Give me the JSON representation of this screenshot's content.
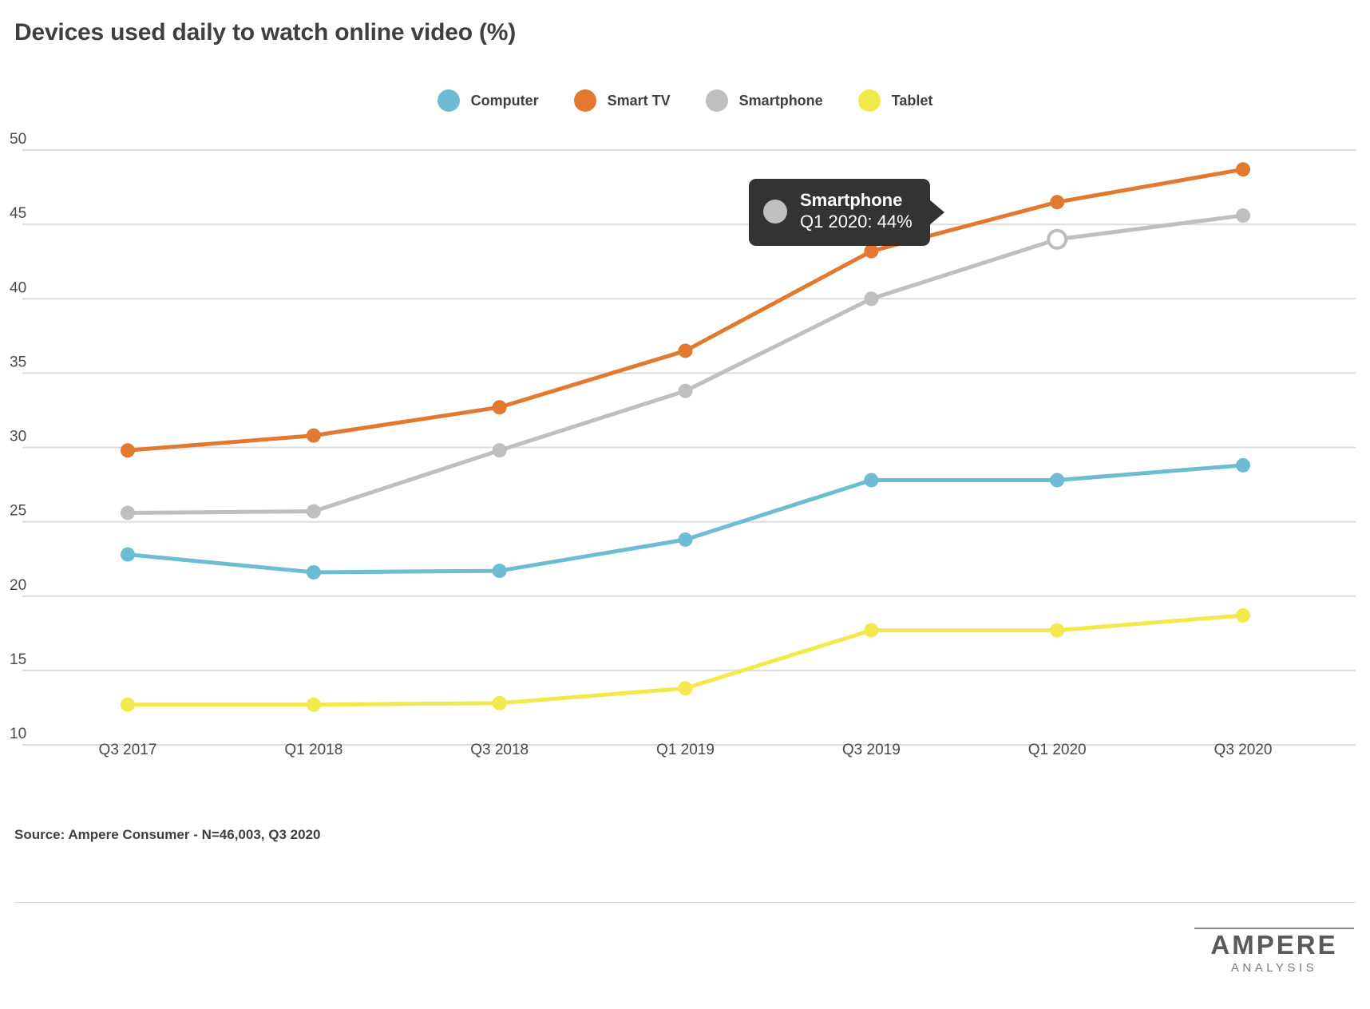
{
  "title": "Devices used daily to watch online video (%)",
  "source": "Source: Ampere Consumer - N=46,003, Q3 2020",
  "brand": {
    "name": "AMPERE",
    "sub": "ANALYSIS"
  },
  "legend": [
    {
      "label": "Computer",
      "color": "#6cbcd4"
    },
    {
      "label": "Smart TV",
      "color": "#e2792f"
    },
    {
      "label": "Smartphone",
      "color": "#bfbfbf"
    },
    {
      "label": "Tablet",
      "color": "#f2ea4c"
    }
  ],
  "tooltip": {
    "series": "Smartphone",
    "value_line": "Q1 2020: 44%",
    "color": "#bfbfbf",
    "highlight_point": {
      "x_label": "Q1 2020",
      "y": 44
    }
  },
  "chart_data": {
    "type": "line",
    "title": "Devices used daily to watch online video (%)",
    "xlabel": "",
    "ylabel": "",
    "ylim": [
      10,
      50
    ],
    "yticks": [
      10,
      15,
      20,
      25,
      30,
      35,
      40,
      45,
      50
    ],
    "grid": true,
    "legend_position": "top-center",
    "categories": [
      "Q3 2017",
      "Q1 2018",
      "Q3 2018",
      "Q1 2019",
      "Q3 2019",
      "Q1 2020",
      "Q3 2020"
    ],
    "series": [
      {
        "name": "Computer",
        "color": "#6cbcd4",
        "values": [
          22.8,
          21.6,
          21.7,
          23.8,
          27.8,
          27.8,
          28.8
        ]
      },
      {
        "name": "Smart TV",
        "color": "#e2792f",
        "values": [
          29.8,
          30.8,
          32.7,
          36.5,
          43.2,
          46.5,
          48.7
        ]
      },
      {
        "name": "Smartphone",
        "color": "#bfbfbf",
        "values": [
          25.6,
          25.7,
          29.8,
          33.8,
          40.0,
          44.0,
          45.6
        ]
      },
      {
        "name": "Tablet",
        "color": "#f2ea4c",
        "values": [
          12.7,
          12.7,
          12.8,
          13.8,
          17.7,
          17.7,
          18.7
        ]
      }
    ]
  }
}
